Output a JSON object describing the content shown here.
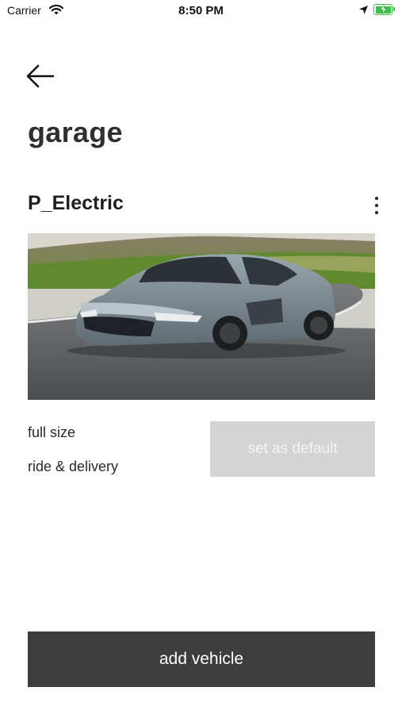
{
  "status_bar": {
    "carrier": "Carrier",
    "time": "8:50 PM",
    "battery_color": "#3cc04a"
  },
  "header": {
    "back_icon": "arrow-left-icon",
    "title": "garage"
  },
  "vehicle": {
    "name": "P_Electric",
    "menu_icon": "more-vertical-icon",
    "specs": [
      "full size",
      "ride & delivery"
    ],
    "set_default_label": "set as default"
  },
  "footer": {
    "add_vehicle_label": "add vehicle"
  },
  "colors": {
    "button_dark": "#3d3d3d",
    "button_disabled": "#d4d4d4"
  }
}
